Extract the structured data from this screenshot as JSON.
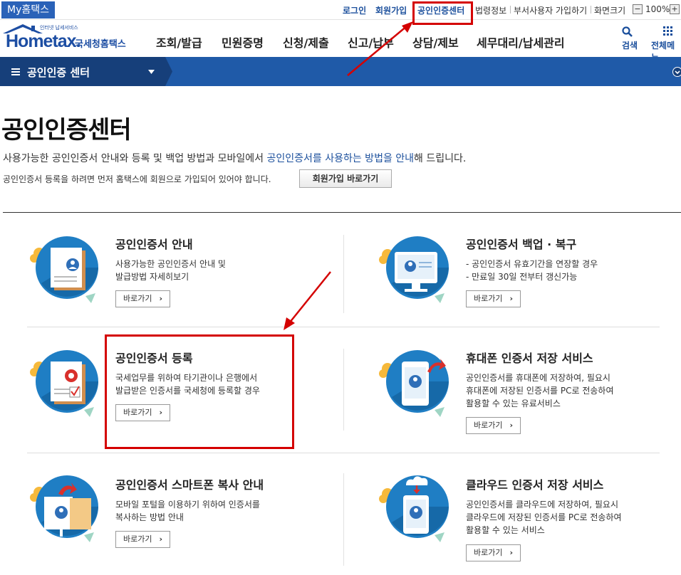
{
  "topbar": {
    "my_tab": "My홈택스",
    "links": [
      {
        "label": "로그인"
      },
      {
        "label": "회원가입"
      },
      {
        "label": "공인인증센터"
      },
      {
        "label": "법령정보"
      },
      {
        "label": "부서사용자 가입하기"
      },
      {
        "label": "화면크기"
      }
    ],
    "zoom_minus": "−",
    "zoom_value": "100%",
    "zoom_plus": "+"
  },
  "header": {
    "logo_text": "Hometax.",
    "logo_sub": "인터넷 납세서비스",
    "logo_kr": "국세청홈택스",
    "nav": [
      "조회/발급",
      "민원증명",
      "신청/제출",
      "신고/납부",
      "상담/제보",
      "세무대리/납세관리"
    ],
    "search_label": "검색",
    "menu_label": "전체메뉴"
  },
  "breadcrumb": {
    "label": "공인인증 센터"
  },
  "page": {
    "title": "공인인증센터",
    "intro_pre": "사용가능한 공인인증서 안내와 등록 및 백업 방법과 모바일에서 ",
    "intro_hl": "공인인증서를 사용하는 방법을 안내",
    "intro_post": "해 드립니다.",
    "join_note": "공인인증서 등록을 하려면 먼저 홈택스에 회원으로 가입되어 있어야 합니다.",
    "join_button": "회원가입 바로가기"
  },
  "cards": [
    {
      "title": "공인인증서 안내",
      "desc": [
        "사용가능한 공인인증서 안내 및",
        "발급방법 자세히보기"
      ],
      "button": "바로가기"
    },
    {
      "title": "공인인증서 백업 · 복구",
      "desc": [
        "- 공인인증서 유효기간을 연장할 경우",
        "- 만료일 30일 전부터 갱신가능"
      ],
      "button": "바로가기"
    },
    {
      "title": "공인인증서 등록",
      "desc": [
        "국세업무를 위하여 타기관이나 은행에서",
        "발급받은 인증서를 국세청에 등록할 경우"
      ],
      "button": "바로가기"
    },
    {
      "title": "휴대폰 인증서 저장 서비스",
      "desc": [
        "공인인증서를 휴대폰에 저장하여, 필요시",
        "휴대폰에 저장된 인증서를 PC로 전송하여",
        "활용할 수 있는 유료서비스"
      ],
      "button": "바로가기"
    },
    {
      "title": "공인인증서 스마트폰 복사 안내",
      "desc": [
        "모바일 포털을 이용하기 위하여 인증서를",
        "복사하는 방법 안내"
      ],
      "button": "바로가기"
    },
    {
      "title": "클라우드 인증서 저장 서비스",
      "desc": [
        "공인인증서를 클라우드에 저장하여, 필요시",
        "클라우드에 저장된 인증서를 PC로 전송하여",
        "활용할 수 있는 서비스"
      ],
      "button": "바로가기"
    }
  ],
  "colors": {
    "accent": "#1f5aa8",
    "highlight": "#d40000"
  }
}
